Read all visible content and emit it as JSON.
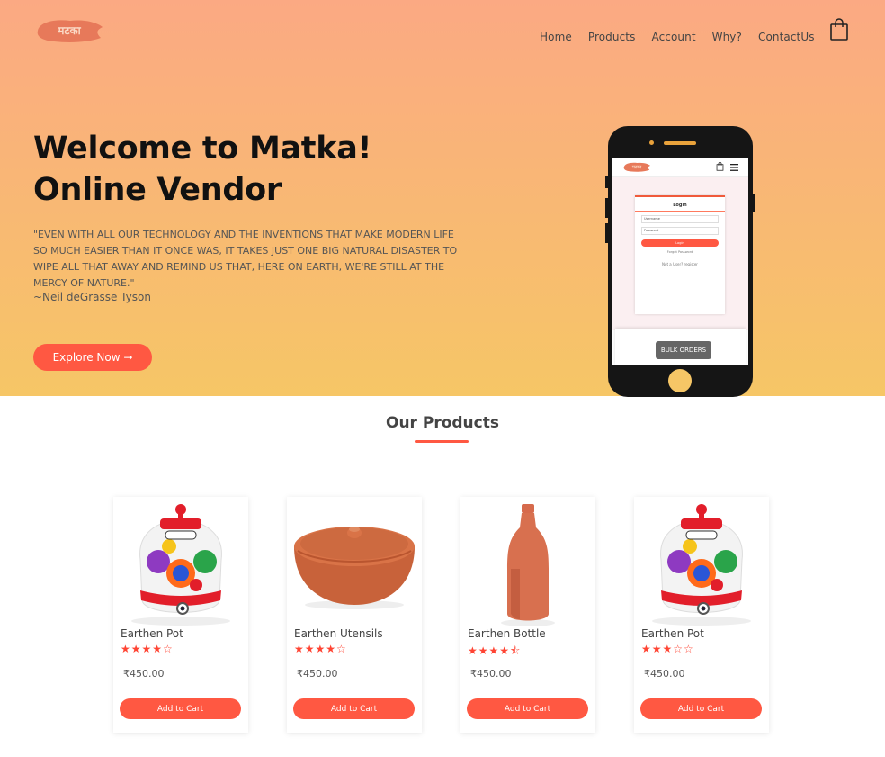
{
  "brand": {
    "logo_text": "मटका",
    "logo_color": "#e7795a"
  },
  "nav": {
    "items": [
      "Home",
      "Products",
      "Account",
      "Why?",
      "ContactUs"
    ]
  },
  "hero": {
    "title_line1": "Welcome to Matka!",
    "title_line2": "Online Vendor",
    "quote": "\"EVEN WITH ALL OUR TECHNOLOGY AND THE INVENTIONS THAT MAKE MODERN LIFE SO MUCH EASIER THAN IT ONCE WAS, IT TAKES JUST ONE BIG NATURAL DISASTER TO WIPE ALL THAT AWAY AND REMIND US THAT, HERE ON EARTH, WE'RE STILL AT THE MERCY OF NATURE.\"",
    "author": "~Neil deGrasse Tyson",
    "cta_label": "Explore Now →"
  },
  "phone_mockup": {
    "login_title": "Login",
    "username_placeholder": "Username",
    "password_placeholder": "Password",
    "login_button": "Login",
    "forgot": "Forgot Password",
    "register": "Not a User? register",
    "bulk_orders": "BULK ORDERS"
  },
  "products_section": {
    "title": "Our Products"
  },
  "products": [
    {
      "name": "Earthen Pot",
      "stars": "★★★★☆",
      "rating": 4,
      "price": "₹450.00",
      "button": "Add to Cart",
      "image": "painted-pot"
    },
    {
      "name": "Earthen Utensils",
      "stars": "★★★★☆",
      "rating": 4,
      "price": "₹450.00",
      "button": "Add to Cart",
      "image": "clay-handi"
    },
    {
      "name": "Earthen Bottle",
      "stars": "★★★★⯪",
      "rating": 4.5,
      "price": "₹450.00",
      "button": "Add to Cart",
      "image": "clay-bottle"
    },
    {
      "name": "Earthen Pot",
      "stars": "★★★☆☆",
      "rating": 3,
      "price": "₹450.00",
      "button": "Add to Cart",
      "image": "painted-pot"
    }
  ],
  "colors": {
    "accent": "#ff5842",
    "hero_top": "#fba983",
    "hero_bottom": "#f6c666"
  }
}
